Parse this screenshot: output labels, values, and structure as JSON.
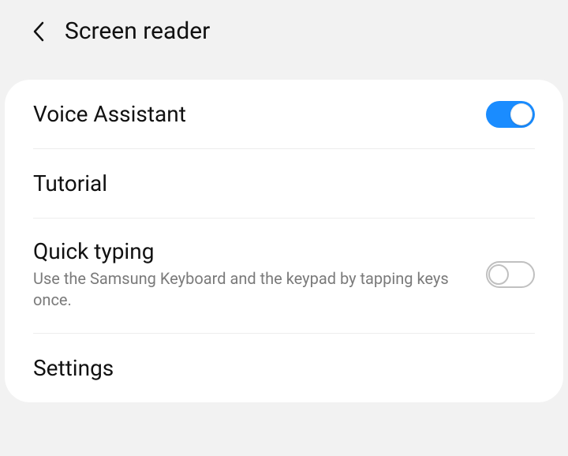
{
  "header": {
    "title": "Screen reader"
  },
  "items": [
    {
      "title": "Voice Assistant",
      "desc": null,
      "toggle": {
        "present": true,
        "on": true
      }
    },
    {
      "title": "Tutorial",
      "desc": null,
      "toggle": {
        "present": false
      }
    },
    {
      "title": "Quick typing",
      "desc": "Use the Samsung Keyboard and the keypad by tapping keys once.",
      "toggle": {
        "present": true,
        "on": false
      }
    },
    {
      "title": "Settings",
      "desc": null,
      "toggle": {
        "present": false
      }
    }
  ]
}
